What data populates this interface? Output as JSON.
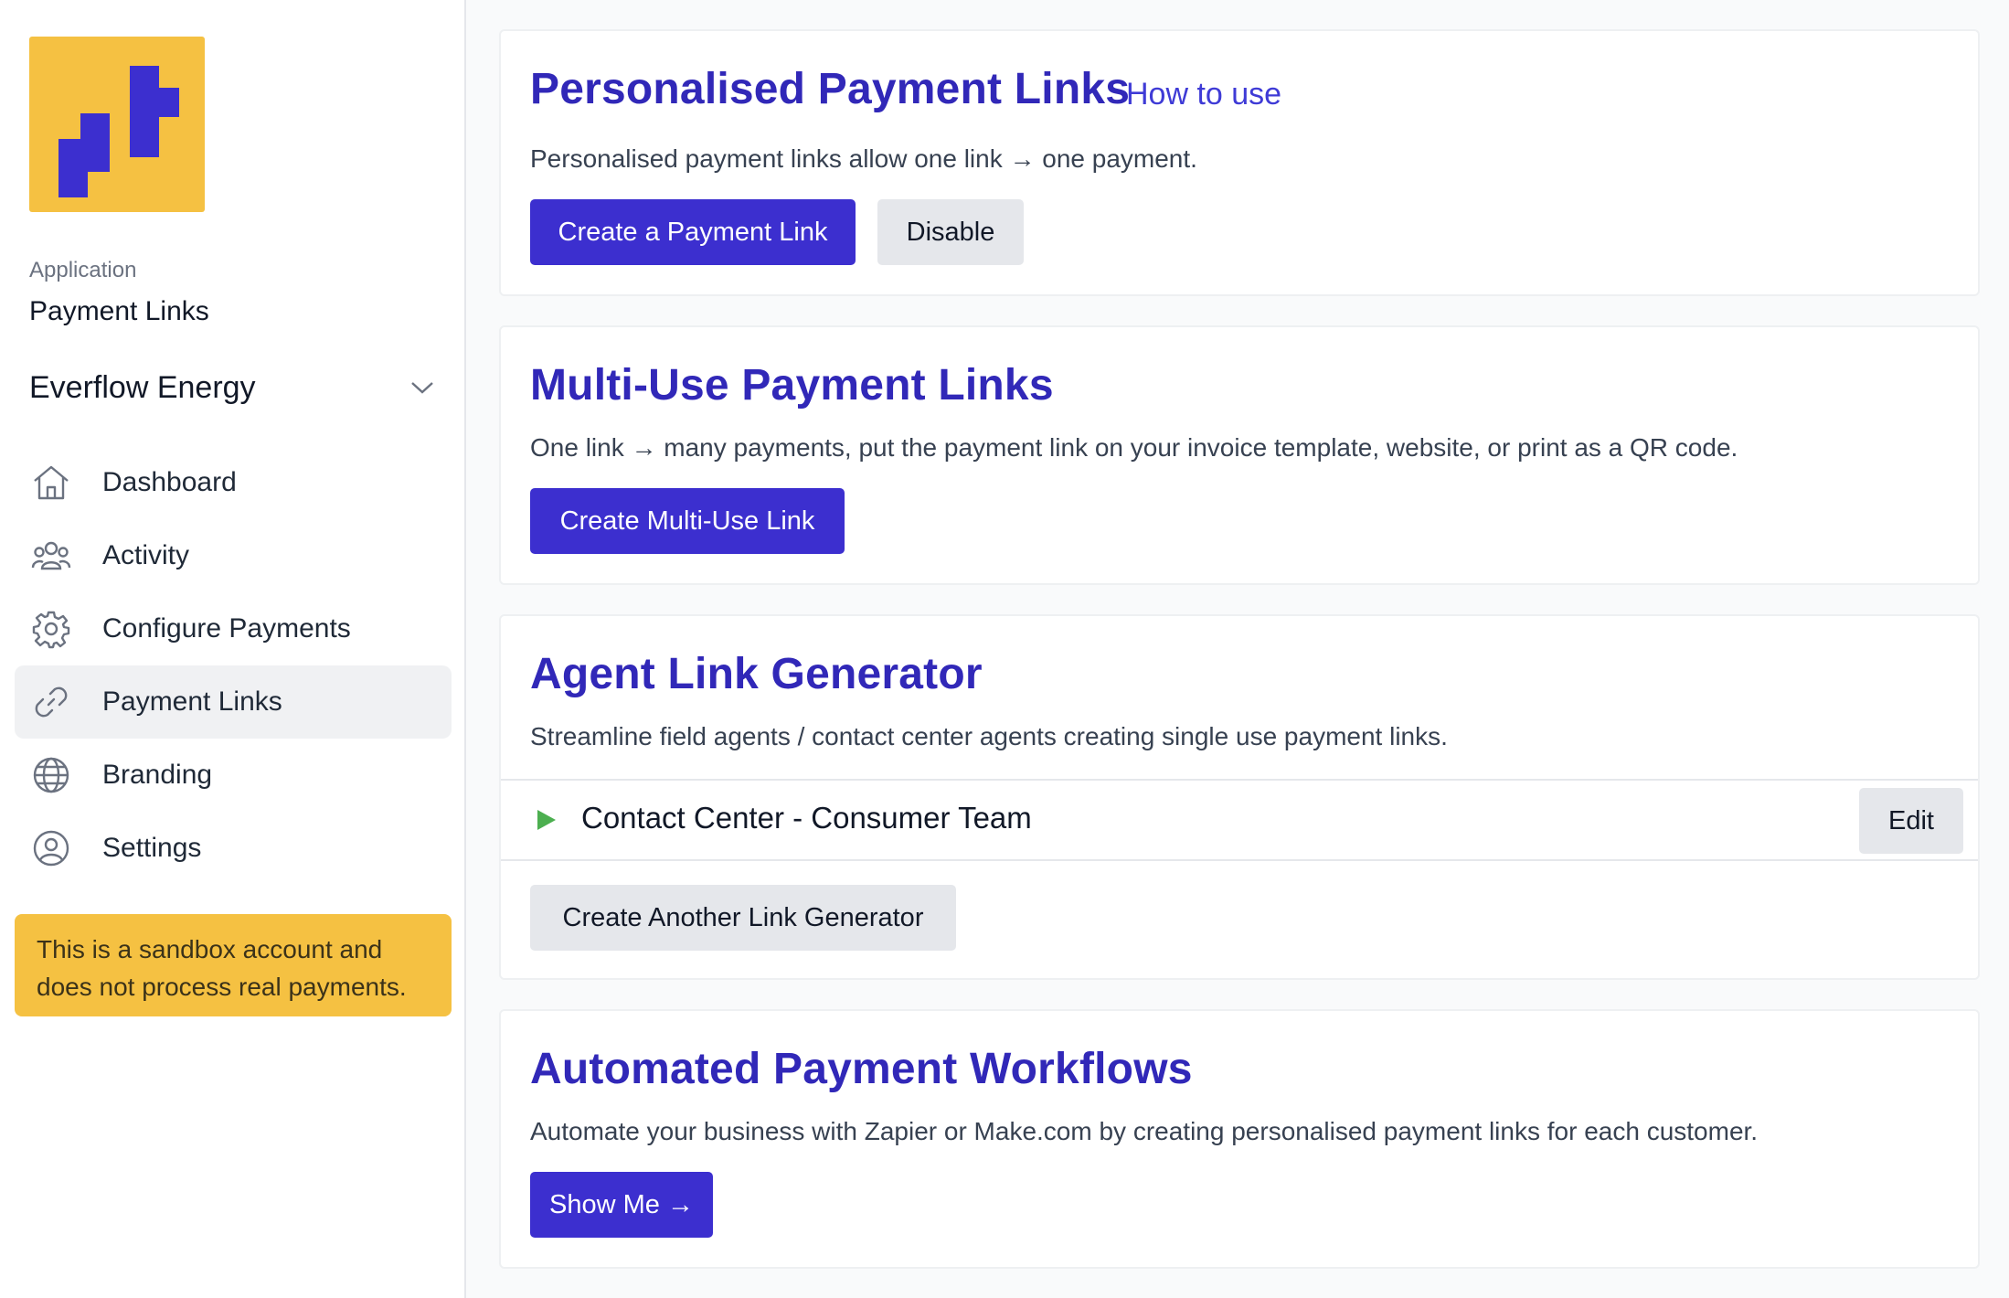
{
  "sidebar": {
    "app_caption": "Application",
    "app_name": "Payment Links",
    "org_name": "Everflow Energy",
    "nav": [
      {
        "label": "Dashboard",
        "icon": "home-icon"
      },
      {
        "label": "Activity",
        "icon": "users-icon"
      },
      {
        "label": "Configure Payments",
        "icon": "gear-icon"
      },
      {
        "label": "Payment Links",
        "icon": "link-icon",
        "active": true
      },
      {
        "label": "Branding",
        "icon": "globe-icon"
      },
      {
        "label": "Settings",
        "icon": "user-circle-icon"
      }
    ],
    "sandbox_notice_line1": "This is a sandbox account and",
    "sandbox_notice_line2": "does not process real payments."
  },
  "cards": {
    "personalised": {
      "title": "Personalised Payment Links",
      "help_link": "How to use",
      "description": "Personalised payment links allow one link → one payment.",
      "create_button": "Create a Payment Link",
      "disable_button": "Disable"
    },
    "multi_use": {
      "title": "Multi-Use Payment Links",
      "description": "One link → many payments, put the payment link on your invoice template, website, or print as a QR code.",
      "create_button": "Create Multi-Use Link"
    },
    "agent": {
      "title": "Agent Link Generator",
      "description": "Streamline field agents / contact center agents creating single use payment links.",
      "generators": [
        {
          "name": "Contact Center - Consumer Team",
          "edit_label": "Edit",
          "status_icon": "play-icon"
        }
      ],
      "create_another_button": "Create Another Link Generator"
    },
    "workflows": {
      "title": "Automated Payment Workflows",
      "description": "Automate your business with Zapier or Make.com by creating personalised payment links for each customer.",
      "show_me_button": "Show Me →"
    }
  },
  "colors": {
    "brand_yellow": "#f5c142",
    "brand_indigo": "#3c2fcf",
    "title_indigo": "#3128b8",
    "status_green": "#4caf50"
  }
}
